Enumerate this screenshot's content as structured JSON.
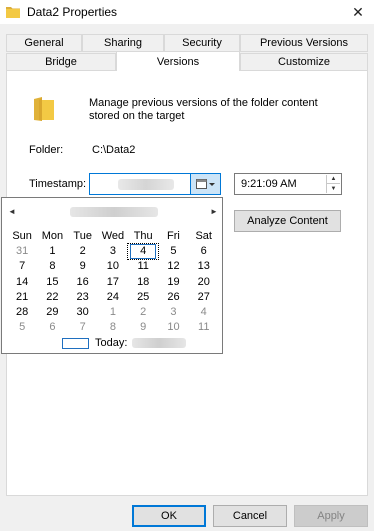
{
  "window": {
    "title": "Data2 Properties",
    "close_glyph": "✕"
  },
  "tabs_row1": [
    "General",
    "Sharing",
    "Security",
    "Previous Versions"
  ],
  "tabs_row2": [
    "Bridge",
    "Versions",
    "Customize"
  ],
  "active_tab": "Versions",
  "description": "Manage previous versions of the folder content stored on the target",
  "folder": {
    "label": "Folder:",
    "value": "C:\\Data2"
  },
  "timestamp": {
    "label": "Timestamp:",
    "time": "9:21:09 AM"
  },
  "analyze_label": "Analyze Content",
  "calendar": {
    "prev_glyph": "◄",
    "next_glyph": "►",
    "weekdays": [
      "Sun",
      "Mon",
      "Tue",
      "Wed",
      "Thu",
      "Fri",
      "Sat"
    ],
    "weeks": [
      [
        "31",
        "1",
        "2",
        "3",
        "4",
        "5",
        "6"
      ],
      [
        "7",
        "8",
        "9",
        "10",
        "11",
        "12",
        "13"
      ],
      [
        "14",
        "15",
        "16",
        "17",
        "18",
        "19",
        "20"
      ],
      [
        "21",
        "22",
        "23",
        "24",
        "25",
        "26",
        "27"
      ],
      [
        "28",
        "29",
        "30",
        "1",
        "2",
        "3",
        "4"
      ],
      [
        "5",
        "6",
        "7",
        "8",
        "9",
        "10",
        "11"
      ]
    ],
    "dim_leading": 1,
    "dim_trailing_from": "4,3",
    "selected": "4",
    "today_label": "Today:"
  },
  "buttons": {
    "ok": "OK",
    "cancel": "Cancel",
    "apply": "Apply"
  },
  "colors": {
    "accent": "#0078d7",
    "folder": "#f3c944"
  }
}
